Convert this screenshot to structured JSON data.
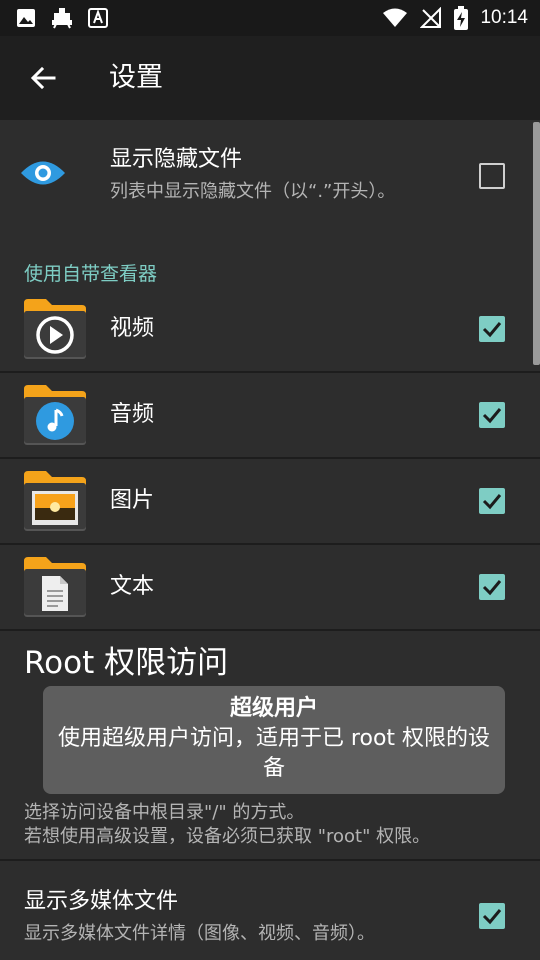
{
  "status": {
    "time": "10:14"
  },
  "header": {
    "title": "设置"
  },
  "hidden_files": {
    "title": "显示隐藏文件",
    "desc": "列表中显示隐藏文件（以“.”开头）。",
    "checked": false
  },
  "section": {
    "title": "使用自带查看器"
  },
  "viewers": [
    {
      "label": "视频",
      "checked": true
    },
    {
      "label": "音频",
      "checked": true
    },
    {
      "label": "图片",
      "checked": true
    },
    {
      "label": "文本",
      "checked": true
    }
  ],
  "root": {
    "title": "Root 权限访问",
    "desc_line1": "选择访问设备中根目录\"/\" 的方式。",
    "desc_line2": "若想使用高级设置，设备必须已获取 \"root\" 权限。"
  },
  "tooltip": {
    "title": "超级用户",
    "body": "使用超级用户访问，适用于已 root 权限的设备"
  },
  "media": {
    "title": "显示多媒体文件",
    "desc": "显示多媒体文件详情（图像、视频、音频）。",
    "checked": true
  },
  "colors": {
    "accent": "#7ecdc4",
    "folder": "#f4a31a",
    "eye": "#2f9ae0"
  }
}
